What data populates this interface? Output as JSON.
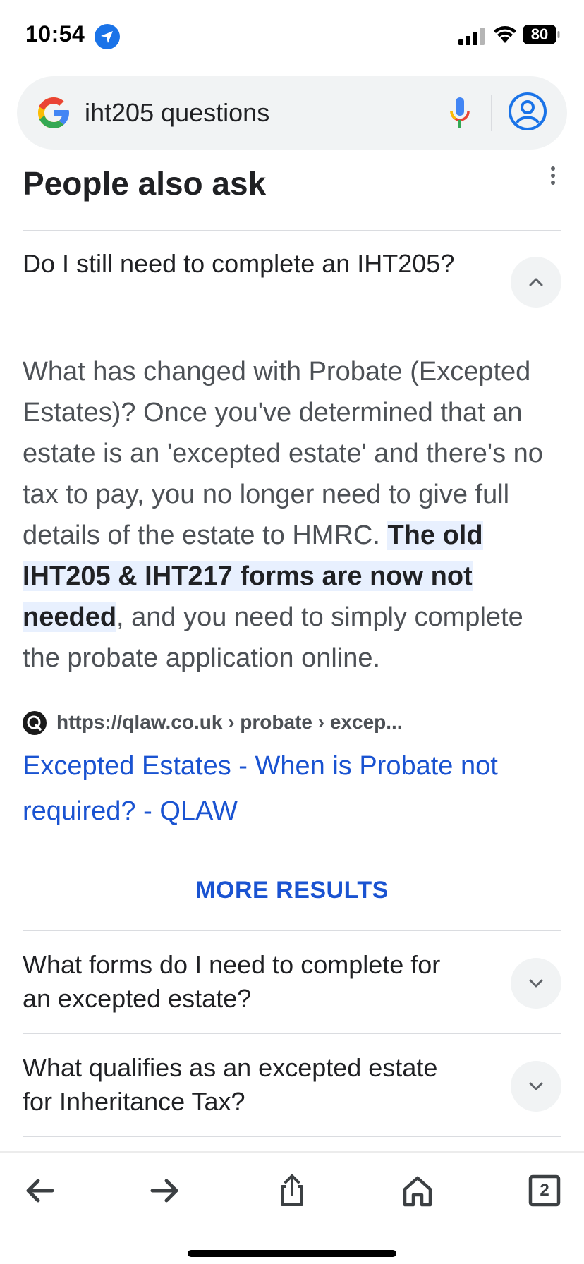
{
  "status_bar": {
    "time": "10:54",
    "battery": "80",
    "icons": [
      "location-arrow-icon",
      "cellular-signal-icon",
      "wifi-icon",
      "battery-icon"
    ]
  },
  "search": {
    "query": "iht205 questions",
    "icons": [
      "google-g-icon",
      "mic-icon",
      "account-icon"
    ]
  },
  "people_also_ask": {
    "title": "People also ask",
    "questions": [
      {
        "text": "Do I still need to complete an IHT205?",
        "expanded": true,
        "answer_pre": "What has changed with Probate (Excepted Estates)? Once you've determined that an estate is an 'excepted estate' and there's no tax to pay, you no longer need to give full details of the estate to HMRC. ",
        "answer_highlight": "The old IHT205 & IHT217 forms are now not needed",
        "answer_post": ", and you need to simply complete the probate application online.",
        "source_url": "https://qlaw.co.uk › probate › excep...",
        "source_title": "Excepted Estates - When is Probate not required? - QLAW"
      },
      {
        "text": "What forms do I need to complete for an excepted estate?",
        "expanded": false
      },
      {
        "text": "What qualifies as an excepted estate for Inheritance Tax?",
        "expanded": false
      }
    ],
    "more_results": "MORE RESULTS"
  },
  "toolbar": {
    "tabs_count": "2",
    "icons": [
      "back-arrow-icon",
      "forward-arrow-icon",
      "share-icon",
      "home-icon",
      "tabs-icon"
    ]
  },
  "colors": {
    "link": "#1a53d1",
    "highlight_bg": "#e8f0fe",
    "chip_bg": "#f1f3f4",
    "divider": "#dadce0"
  }
}
